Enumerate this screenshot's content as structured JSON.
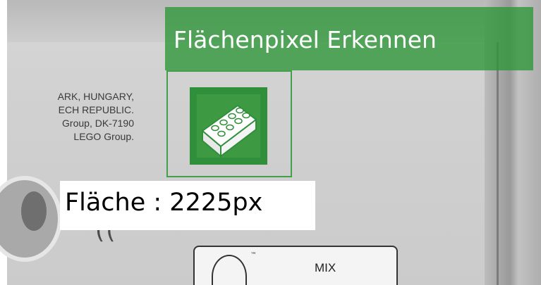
{
  "overlay": {
    "title": "Flächenpixel Erkennen",
    "area_label": "Fläche : 2225px",
    "accent_color": "#2c9636",
    "area_label_background": "#ffffff"
  },
  "scene": {
    "printed_lines": [
      "ARK, HUNGARY,",
      "ECH REPUBLIC.",
      "Group, DK-7190",
      "LEGO Group."
    ],
    "fsc_text": "MIX",
    "fsc_trademark": "™",
    "recycling_icon": "recycling-arrows-icon",
    "logo_icon": "lego-brick-icon"
  }
}
